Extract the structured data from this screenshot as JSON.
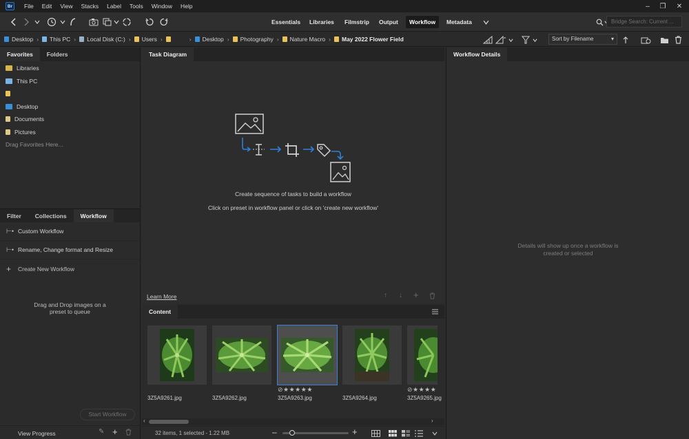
{
  "menubar": {
    "app_logo": "Br",
    "items": [
      "File",
      "Edit",
      "View",
      "Stacks",
      "Label",
      "Tools",
      "Window",
      "Help"
    ]
  },
  "toolbar": {
    "workspaces": [
      "Essentials",
      "Libraries",
      "Filmstrip",
      "Output",
      "Workflow",
      "Metadata"
    ],
    "active_workspace": "Workflow",
    "search_placeholder": "Bridge Search: Current ..."
  },
  "pathbar": {
    "crumbs": [
      "Desktop",
      "This PC",
      "Local Disk (C:)",
      "Users",
      "",
      "Desktop",
      "Photography",
      "Nature Macro",
      "May 2022 Flower Field"
    ],
    "sort_label": "Sort by Filename"
  },
  "favorites_panel": {
    "tabs": [
      "Favorites",
      "Folders"
    ],
    "items": [
      "Libraries",
      "This PC",
      "",
      "Desktop",
      "Documents",
      "Pictures"
    ],
    "hint": "Drag Favorites Here..."
  },
  "workflow_panel": {
    "tabs": [
      "Filter",
      "Collections",
      "Workflow"
    ],
    "items": [
      "Custom Workflow",
      "Rename, Change format and Resize"
    ],
    "create_label": "Create New Workflow",
    "drop_hint_1": "Drag and Drop images on a",
    "drop_hint_2": "preset to queue",
    "start_label": "Start Workflow",
    "view_progress": "View Progress"
  },
  "task_panel": {
    "tab": "Task Diagram",
    "line1": "Create sequence of tasks to build a workflow",
    "line2": "Click on preset in workflow panel or click on 'create new workflow'",
    "learn_more": "Learn More"
  },
  "content_panel": {
    "tab": "Content",
    "thumbnails": [
      "3Z5A9261.jpg",
      "3Z5A9262.jpg",
      "3Z5A9263.jpg",
      "3Z5A9264.jpg",
      "3Z5A9265.jpg"
    ],
    "status": "32 items, 1 selected - 1.22 MB"
  },
  "details_panel": {
    "tab": "Workflow Details",
    "hint_1": "Details will show up once a workflow is",
    "hint_2": "created or selected"
  },
  "colors": {
    "accent": "#3d7fd6",
    "folder": "#e9c25a",
    "panel_bg": "#2d2d2d"
  }
}
